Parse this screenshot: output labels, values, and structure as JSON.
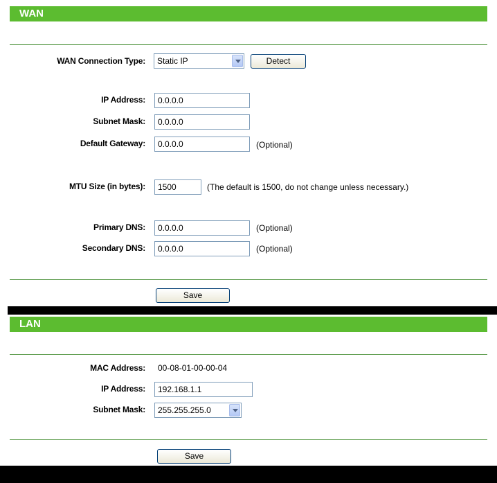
{
  "wan": {
    "title": "WAN",
    "connection_type_label": "WAN Connection Type:",
    "connection_type_value": "Static IP",
    "detect_label": "Detect",
    "ip_label": "IP Address:",
    "ip_value": "0.0.0.0",
    "mask_label": "Subnet Mask:",
    "mask_value": "0.0.0.0",
    "gateway_label": "Default Gateway:",
    "gateway_value": "0.0.0.0",
    "gateway_note": "(Optional)",
    "mtu_label": "MTU Size (in bytes):",
    "mtu_value": "1500",
    "mtu_note": "(The default is 1500, do not change unless necessary.)",
    "dns1_label": "Primary DNS:",
    "dns1_value": "0.0.0.0",
    "dns1_note": "(Optional)",
    "dns2_label": "Secondary DNS:",
    "dns2_value": "0.0.0.0",
    "dns2_note": "(Optional)",
    "save_label": "Save"
  },
  "lan": {
    "title": "LAN",
    "mac_label": "MAC Address:",
    "mac_value": "00-08-01-00-00-04",
    "ip_label": "IP Address:",
    "ip_value": "192.168.1.1",
    "mask_label": "Subnet Mask:",
    "mask_value": "255.255.255.0",
    "save_label": "Save"
  },
  "colors": {
    "header_green": "#5cbc30",
    "divider": "#5a9a4a",
    "background": "#000000"
  }
}
